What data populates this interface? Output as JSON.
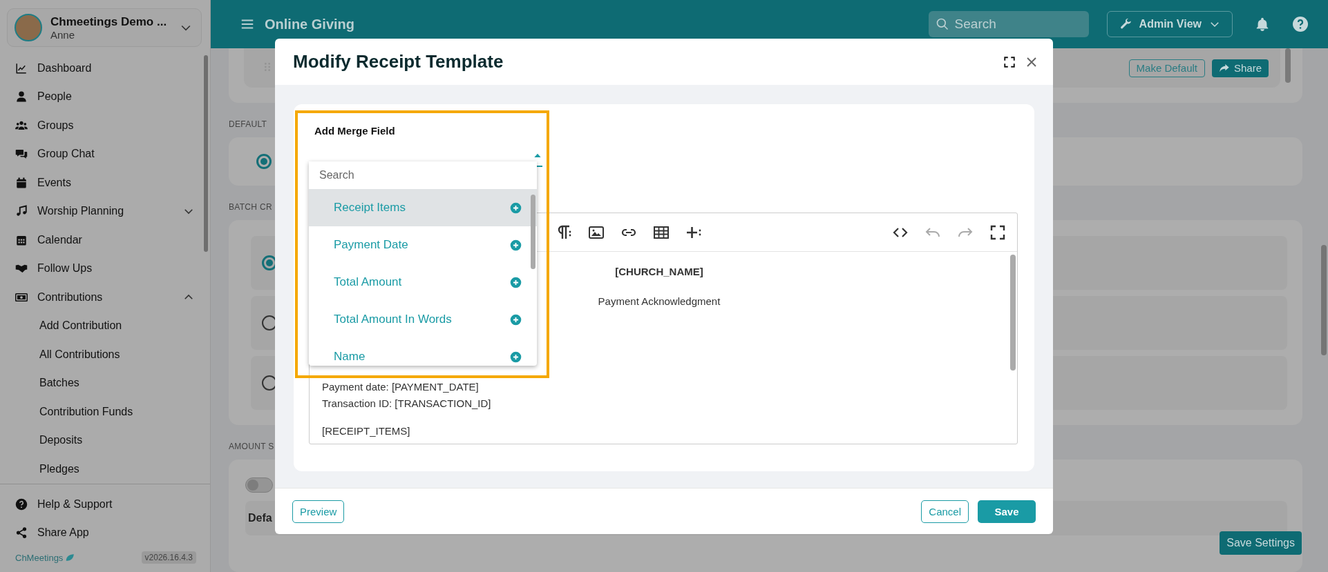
{
  "sidebar": {
    "org_name": "Chmeetings Demo ...",
    "user": "Anne",
    "items": [
      {
        "label": "Dashboard"
      },
      {
        "label": "People"
      },
      {
        "label": "Groups"
      },
      {
        "label": "Group Chat"
      },
      {
        "label": "Events"
      },
      {
        "label": "Worship Planning",
        "expanded": false
      },
      {
        "label": "Calendar"
      },
      {
        "label": "Follow Ups"
      },
      {
        "label": "Contributions",
        "expanded": true,
        "children": [
          {
            "label": "Add Contribution"
          },
          {
            "label": "All Contributions"
          },
          {
            "label": "Batches"
          },
          {
            "label": "Contribution Funds"
          },
          {
            "label": "Deposits"
          },
          {
            "label": "Pledges"
          }
        ]
      }
    ],
    "footer_items": [
      {
        "label": "Help & Support"
      },
      {
        "label": "Share App"
      }
    ],
    "brand": "ChMeetings",
    "version": "v2026.16.4.3"
  },
  "header": {
    "title": "Online Giving",
    "search_placeholder": "Search",
    "admin_button": "Admin View"
  },
  "page": {
    "top_buttons": [
      {
        "label": "Make Default",
        "kind": "outline"
      },
      {
        "label": "Share",
        "kind": "primary"
      }
    ],
    "sections": [
      {
        "label": "DEFAULT",
        "options": [
          {
            "selected": true
          }
        ]
      },
      {
        "label": "BATCH CR",
        "options": [
          {
            "selected": true
          },
          {
            "selected": false
          },
          {
            "selected": false
          }
        ]
      },
      {
        "label": "AMOUNT S",
        "toggle": {
          "on": false
        },
        "heading": "Defa"
      }
    ],
    "save_button": "Save Settings"
  },
  "modal": {
    "title": "Modify Receipt Template",
    "merge_field": {
      "label": "Add Merge Field",
      "expanded": true,
      "search_placeholder": "Search",
      "options": [
        {
          "label": "Receipt Items",
          "selected": true
        },
        {
          "label": "Payment Date",
          "selected": false
        },
        {
          "label": "Total Amount",
          "selected": false
        },
        {
          "label": "Total Amount In Words",
          "selected": false
        },
        {
          "label": "Name",
          "selected": false
        }
      ]
    },
    "editor": {
      "tools": [
        {
          "kind": "paragraph",
          "disabled": false
        },
        {
          "kind": "image",
          "disabled": false
        },
        {
          "kind": "link",
          "disabled": false
        },
        {
          "kind": "table",
          "disabled": false
        },
        {
          "kind": "insert",
          "disabled": false
        },
        {
          "kind": "code",
          "disabled": false
        },
        {
          "kind": "undo",
          "disabled": true
        },
        {
          "kind": "redo",
          "disabled": true
        },
        {
          "kind": "fullscreen",
          "disabled": false
        }
      ],
      "lines": [
        {
          "text": "[CHURCH_NAME]",
          "kind": "heading"
        },
        {
          "text": "Payment Acknowledgment",
          "kind": "subtitle"
        },
        {
          "text": "Payment date: [PAYMENT_DATE]",
          "kind": "body"
        },
        {
          "text": "Transaction ID: [TRANSACTION_ID]",
          "kind": "body"
        },
        {
          "text": "[RECEIPT_ITEMS]",
          "kind": "body"
        }
      ]
    },
    "footer": {
      "preview": "Preview",
      "cancel": "Cancel",
      "save": "Save"
    }
  }
}
